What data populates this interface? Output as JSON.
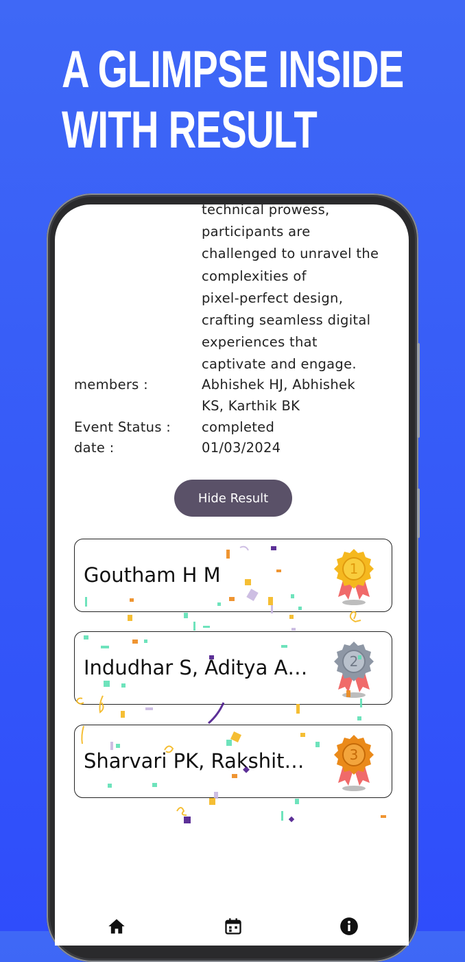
{
  "headline": {
    "line1": "A GLIMPSE INSIDE",
    "line2": "WITH RESULT"
  },
  "event": {
    "description_lines": [
      "technical prowess,",
      "participants are",
      "challenged to unravel the",
      "complexities of",
      "pixel-perfect design,",
      "crafting seamless digital",
      "experiences that",
      "captivate and engage."
    ],
    "members_label": "members :",
    "members_lines": [
      "Abhishek HJ, Abhishek",
      "KS, Karthik BK"
    ],
    "status_label": "Event Status :",
    "status_value": "completed",
    "date_label": "date :",
    "date_value": "01/03/2024"
  },
  "hide_result_label": "Hide Result",
  "results": [
    {
      "name": "Goutham H M",
      "place": "1",
      "medal": "gold-medal-icon",
      "color": "#f5b81f"
    },
    {
      "name": "Indudhar S, Aditya A…",
      "place": "2",
      "medal": "silver-medal-icon",
      "color": "#9aa3b0"
    },
    {
      "name": "Sharvari PK, Rakshit…",
      "place": "3",
      "medal": "bronze-medal-icon",
      "color": "#ee8a1c"
    }
  ],
  "nav": [
    {
      "icon": "home-icon"
    },
    {
      "icon": "calendar-icon"
    },
    {
      "icon": "info-icon"
    }
  ],
  "colors": {
    "background_top": "#3f68f6",
    "background_bottom": "#2f4dfb",
    "button": "#5a5168",
    "medal_ribbon": "#f06a6a"
  }
}
